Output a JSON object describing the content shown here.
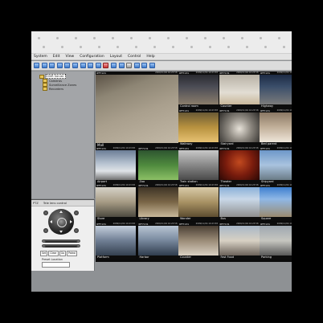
{
  "menu": [
    "System",
    "Edit",
    "View",
    "Configuration",
    "Layout",
    "Control",
    "Help"
  ],
  "toolbar": {
    "buttons": [
      "add-camera-icon",
      "remove-camera-icon",
      "layout-1-icon",
      "layout-4-icon",
      "layout-9-icon",
      "layout-16-icon",
      "layout-custom-icon",
      "fullscreen-icon",
      "snapshot-icon",
      "record-icon",
      "stop-icon",
      "playback-icon",
      "settings-icon",
      "grid-icon",
      "back-icon",
      "forward-icon"
    ]
  },
  "tree": {
    "root": "DVR Server",
    "items": [
      "Cameras",
      "Surveillance Zones",
      "Recorders"
    ]
  },
  "ptz": {
    "tab1": "PTZ",
    "tab2": "Tele lens control",
    "presets": [
      "Set",
      "Clear",
      "Go",
      "Patrol"
    ],
    "preset_label": "Preset Location"
  },
  "tiles": [
    {
      "id": "IPF7121",
      "time": "2009/11/04 10:23:58",
      "label": "Mall",
      "big": true,
      "scene": "mall"
    },
    {
      "id": "IPF7131",
      "time": "2009/11/04 10:23:58",
      "label": "Control room",
      "scene": "control"
    },
    {
      "id": "IPF7131",
      "time": "2009/11/04 10:23:58",
      "label": "Counter",
      "scene": "counter"
    },
    {
      "id": "IPF7131",
      "time": "2009/11/04 10:23:58",
      "label": "Highway",
      "scene": "highway"
    },
    {
      "id": "IPF7131",
      "time": "2009/11/04 10:23:58",
      "label": "Walkway",
      "scene": "walkway"
    },
    {
      "id": "IPF7131",
      "time": "2009/11/04 10:23:58",
      "label": "Stairyard",
      "scene": "stair"
    },
    {
      "id": "IPF7131",
      "time": "2009/11/04 10:23:58",
      "label": "Bed parent",
      "scene": "bed"
    },
    {
      "id": "IPF7131",
      "time": "2009/11/04 10:23:58",
      "label": "Airport",
      "scene": "airport"
    },
    {
      "id": "IPF7131",
      "time": "2009/11/04 10:23:58",
      "label": "Zoo",
      "scene": "zoo"
    },
    {
      "id": "IPF7131",
      "time": "2009/11/04 10:23:58",
      "label": "Train station",
      "scene": "train"
    },
    {
      "id": "IPF7131",
      "time": "2009/11/04 10:23:58",
      "label": "Theater",
      "scene": "theater"
    },
    {
      "id": "IPF7131",
      "time": "2009/11/04 10:23:58",
      "label": "Shipyard",
      "scene": "shipyard"
    },
    {
      "id": "IPF7131",
      "time": "2009/11/04 10:23:58",
      "label": "Store",
      "scene": "store"
    },
    {
      "id": "IPF7131",
      "time": "2009/11/04 10:23:58",
      "label": "Library",
      "scene": "library"
    },
    {
      "id": "IPF7131",
      "time": "2009/11/04 10:23:58",
      "label": "Wonder",
      "scene": "wonder"
    },
    {
      "id": "IPF7131",
      "time": "2009/11/04 10:23:58",
      "label": "Bus",
      "scene": "bus"
    },
    {
      "id": "IPF7131",
      "time": "2009/11/04 10:23:58",
      "label": "Square",
      "scene": "square"
    },
    {
      "id": "IPF7131",
      "time": "2009/11/04 10:23:58",
      "label": "Platform",
      "scene": "platform"
    },
    {
      "id": "IPF7131",
      "time": "2009/11/04 10:23:58",
      "label": "Harbor",
      "scene": "harbor"
    },
    {
      "id": "IPF7131",
      "time": "2009/11/04 10:23:58",
      "label": "Counter",
      "scene": "counter2"
    },
    {
      "id": "IPF7131",
      "time": "2009/11/04 10:23:58",
      "label": "Fast Food",
      "scene": "fastfood"
    },
    {
      "id": "IPF7131",
      "time": "2009/11/04 10:23:58",
      "label": "Parking",
      "scene": "parking"
    }
  ]
}
